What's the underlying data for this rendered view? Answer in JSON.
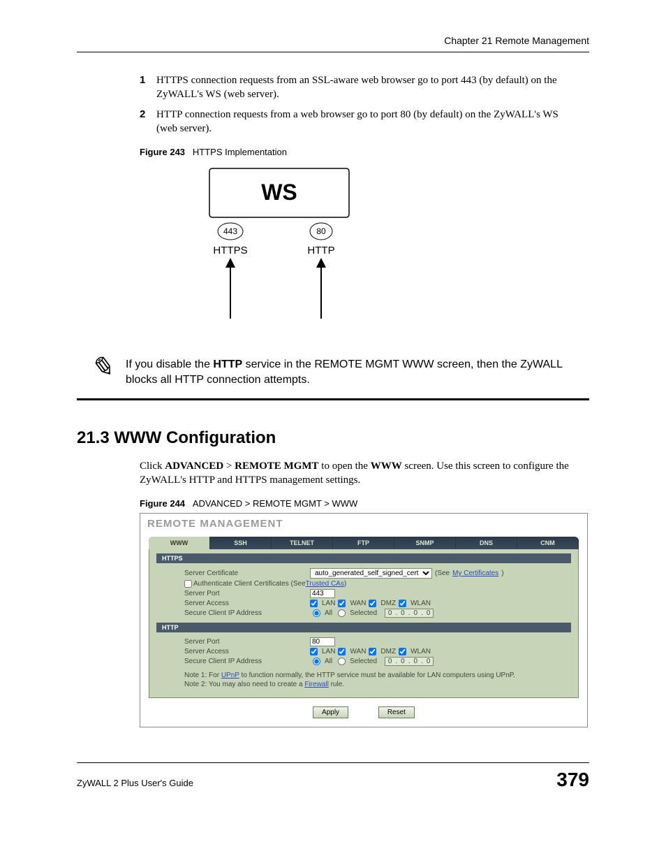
{
  "header": {
    "chapter": "Chapter 21 Remote Management"
  },
  "list": {
    "item1_num": "1",
    "item1_text": "HTTPS connection requests from an SSL-aware web browser go to port 443 (by default) on the ZyWALL's WS (web server).",
    "item2_num": "2",
    "item2_text": "HTTP connection requests from a web browser go to port 80 (by default) on the ZyWALL's WS (web server)."
  },
  "fig243": {
    "num": "Figure 243",
    "caption": "HTTPS Implementation",
    "ws": "WS",
    "port443": "443",
    "port80": "80",
    "https": "HTTPS",
    "http": "HTTP"
  },
  "note": {
    "text_prefix": "If you disable the ",
    "bold": "HTTP",
    "text_suffix": " service in the REMOTE MGMT WWW screen, then the ZyWALL blocks all HTTP connection attempts."
  },
  "section": {
    "heading": "21.3  WWW Configuration",
    "para_prefix": "Click ",
    "adv": "ADVANCED",
    "gt": " > ",
    "rm": "REMOTE MGMT",
    "mid": " to open the ",
    "www": "WWW",
    "suffix": " screen. Use this screen to configure the ZyWALL's HTTP and HTTPS management settings."
  },
  "fig244": {
    "num": "Figure 244",
    "caption": "ADVANCED > REMOTE MGMT > WWW"
  },
  "rm": {
    "title": "REMOTE MANAGEMENT",
    "tabs": {
      "www": "WWW",
      "ssh": "SSH",
      "telnet": "TELNET",
      "ftp": "FTP",
      "snmp": "SNMP",
      "dns": "DNS",
      "cnm": "CNM"
    },
    "https_bar": "HTTPS",
    "http_bar": "HTTP",
    "labels": {
      "server_cert": "Server Certificate",
      "auth_client": "Authenticate Client Certificates (See ",
      "trusted_cas": "Trusted CAs",
      "close_paren": ")",
      "server_port": "Server Port",
      "server_access": "Server Access",
      "secure_ip": "Secure Client IP Address"
    },
    "cert_value": "auto_generated_self_signed_cert",
    "see_label": "(See ",
    "my_certs": "My Certificates",
    "port443": "443",
    "port80": "80",
    "access": {
      "lan": "LAN",
      "wan": "WAN",
      "dmz": "DMZ",
      "wlan": "WLAN"
    },
    "radio": {
      "all": "All",
      "selected": "Selected"
    },
    "ip0": "0",
    "note1_prefix": "Note 1: For ",
    "upnp": "UPnP",
    "note1_suffix": " to function normally, the HTTP service must be available for LAN computers using UPnP.",
    "note2_prefix": "Note 2: You may also need to create a ",
    "firewall": "Firewall",
    "note2_suffix": " rule.",
    "apply": "Apply",
    "reset": "Reset"
  },
  "footer": {
    "left": "ZyWALL 2 Plus User's Guide",
    "right": "379"
  }
}
